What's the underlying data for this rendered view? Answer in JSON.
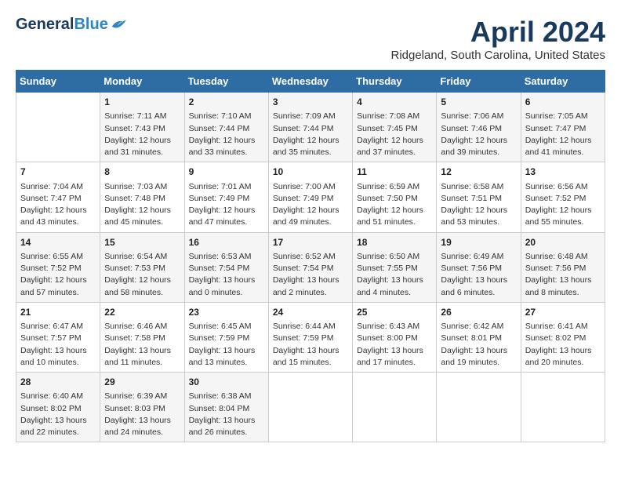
{
  "logo": {
    "general": "General",
    "blue": "Blue"
  },
  "title": "April 2024",
  "location": "Ridgeland, South Carolina, United States",
  "weekdays": [
    "Sunday",
    "Monday",
    "Tuesday",
    "Wednesday",
    "Thursday",
    "Friday",
    "Saturday"
  ],
  "weeks": [
    [
      {
        "day": "",
        "info": ""
      },
      {
        "day": "1",
        "info": "Sunrise: 7:11 AM\nSunset: 7:43 PM\nDaylight: 12 hours\nand 31 minutes."
      },
      {
        "day": "2",
        "info": "Sunrise: 7:10 AM\nSunset: 7:44 PM\nDaylight: 12 hours\nand 33 minutes."
      },
      {
        "day": "3",
        "info": "Sunrise: 7:09 AM\nSunset: 7:44 PM\nDaylight: 12 hours\nand 35 minutes."
      },
      {
        "day": "4",
        "info": "Sunrise: 7:08 AM\nSunset: 7:45 PM\nDaylight: 12 hours\nand 37 minutes."
      },
      {
        "day": "5",
        "info": "Sunrise: 7:06 AM\nSunset: 7:46 PM\nDaylight: 12 hours\nand 39 minutes."
      },
      {
        "day": "6",
        "info": "Sunrise: 7:05 AM\nSunset: 7:47 PM\nDaylight: 12 hours\nand 41 minutes."
      }
    ],
    [
      {
        "day": "7",
        "info": "Sunrise: 7:04 AM\nSunset: 7:47 PM\nDaylight: 12 hours\nand 43 minutes."
      },
      {
        "day": "8",
        "info": "Sunrise: 7:03 AM\nSunset: 7:48 PM\nDaylight: 12 hours\nand 45 minutes."
      },
      {
        "day": "9",
        "info": "Sunrise: 7:01 AM\nSunset: 7:49 PM\nDaylight: 12 hours\nand 47 minutes."
      },
      {
        "day": "10",
        "info": "Sunrise: 7:00 AM\nSunset: 7:49 PM\nDaylight: 12 hours\nand 49 minutes."
      },
      {
        "day": "11",
        "info": "Sunrise: 6:59 AM\nSunset: 7:50 PM\nDaylight: 12 hours\nand 51 minutes."
      },
      {
        "day": "12",
        "info": "Sunrise: 6:58 AM\nSunset: 7:51 PM\nDaylight: 12 hours\nand 53 minutes."
      },
      {
        "day": "13",
        "info": "Sunrise: 6:56 AM\nSunset: 7:52 PM\nDaylight: 12 hours\nand 55 minutes."
      }
    ],
    [
      {
        "day": "14",
        "info": "Sunrise: 6:55 AM\nSunset: 7:52 PM\nDaylight: 12 hours\nand 57 minutes."
      },
      {
        "day": "15",
        "info": "Sunrise: 6:54 AM\nSunset: 7:53 PM\nDaylight: 12 hours\nand 58 minutes."
      },
      {
        "day": "16",
        "info": "Sunrise: 6:53 AM\nSunset: 7:54 PM\nDaylight: 13 hours\nand 0 minutes."
      },
      {
        "day": "17",
        "info": "Sunrise: 6:52 AM\nSunset: 7:54 PM\nDaylight: 13 hours\nand 2 minutes."
      },
      {
        "day": "18",
        "info": "Sunrise: 6:50 AM\nSunset: 7:55 PM\nDaylight: 13 hours\nand 4 minutes."
      },
      {
        "day": "19",
        "info": "Sunrise: 6:49 AM\nSunset: 7:56 PM\nDaylight: 13 hours\nand 6 minutes."
      },
      {
        "day": "20",
        "info": "Sunrise: 6:48 AM\nSunset: 7:56 PM\nDaylight: 13 hours\nand 8 minutes."
      }
    ],
    [
      {
        "day": "21",
        "info": "Sunrise: 6:47 AM\nSunset: 7:57 PM\nDaylight: 13 hours\nand 10 minutes."
      },
      {
        "day": "22",
        "info": "Sunrise: 6:46 AM\nSunset: 7:58 PM\nDaylight: 13 hours\nand 11 minutes."
      },
      {
        "day": "23",
        "info": "Sunrise: 6:45 AM\nSunset: 7:59 PM\nDaylight: 13 hours\nand 13 minutes."
      },
      {
        "day": "24",
        "info": "Sunrise: 6:44 AM\nSunset: 7:59 PM\nDaylight: 13 hours\nand 15 minutes."
      },
      {
        "day": "25",
        "info": "Sunrise: 6:43 AM\nSunset: 8:00 PM\nDaylight: 13 hours\nand 17 minutes."
      },
      {
        "day": "26",
        "info": "Sunrise: 6:42 AM\nSunset: 8:01 PM\nDaylight: 13 hours\nand 19 minutes."
      },
      {
        "day": "27",
        "info": "Sunrise: 6:41 AM\nSunset: 8:02 PM\nDaylight: 13 hours\nand 20 minutes."
      }
    ],
    [
      {
        "day": "28",
        "info": "Sunrise: 6:40 AM\nSunset: 8:02 PM\nDaylight: 13 hours\nand 22 minutes."
      },
      {
        "day": "29",
        "info": "Sunrise: 6:39 AM\nSunset: 8:03 PM\nDaylight: 13 hours\nand 24 minutes."
      },
      {
        "day": "30",
        "info": "Sunrise: 6:38 AM\nSunset: 8:04 PM\nDaylight: 13 hours\nand 26 minutes."
      },
      {
        "day": "",
        "info": ""
      },
      {
        "day": "",
        "info": ""
      },
      {
        "day": "",
        "info": ""
      },
      {
        "day": "",
        "info": ""
      }
    ]
  ]
}
